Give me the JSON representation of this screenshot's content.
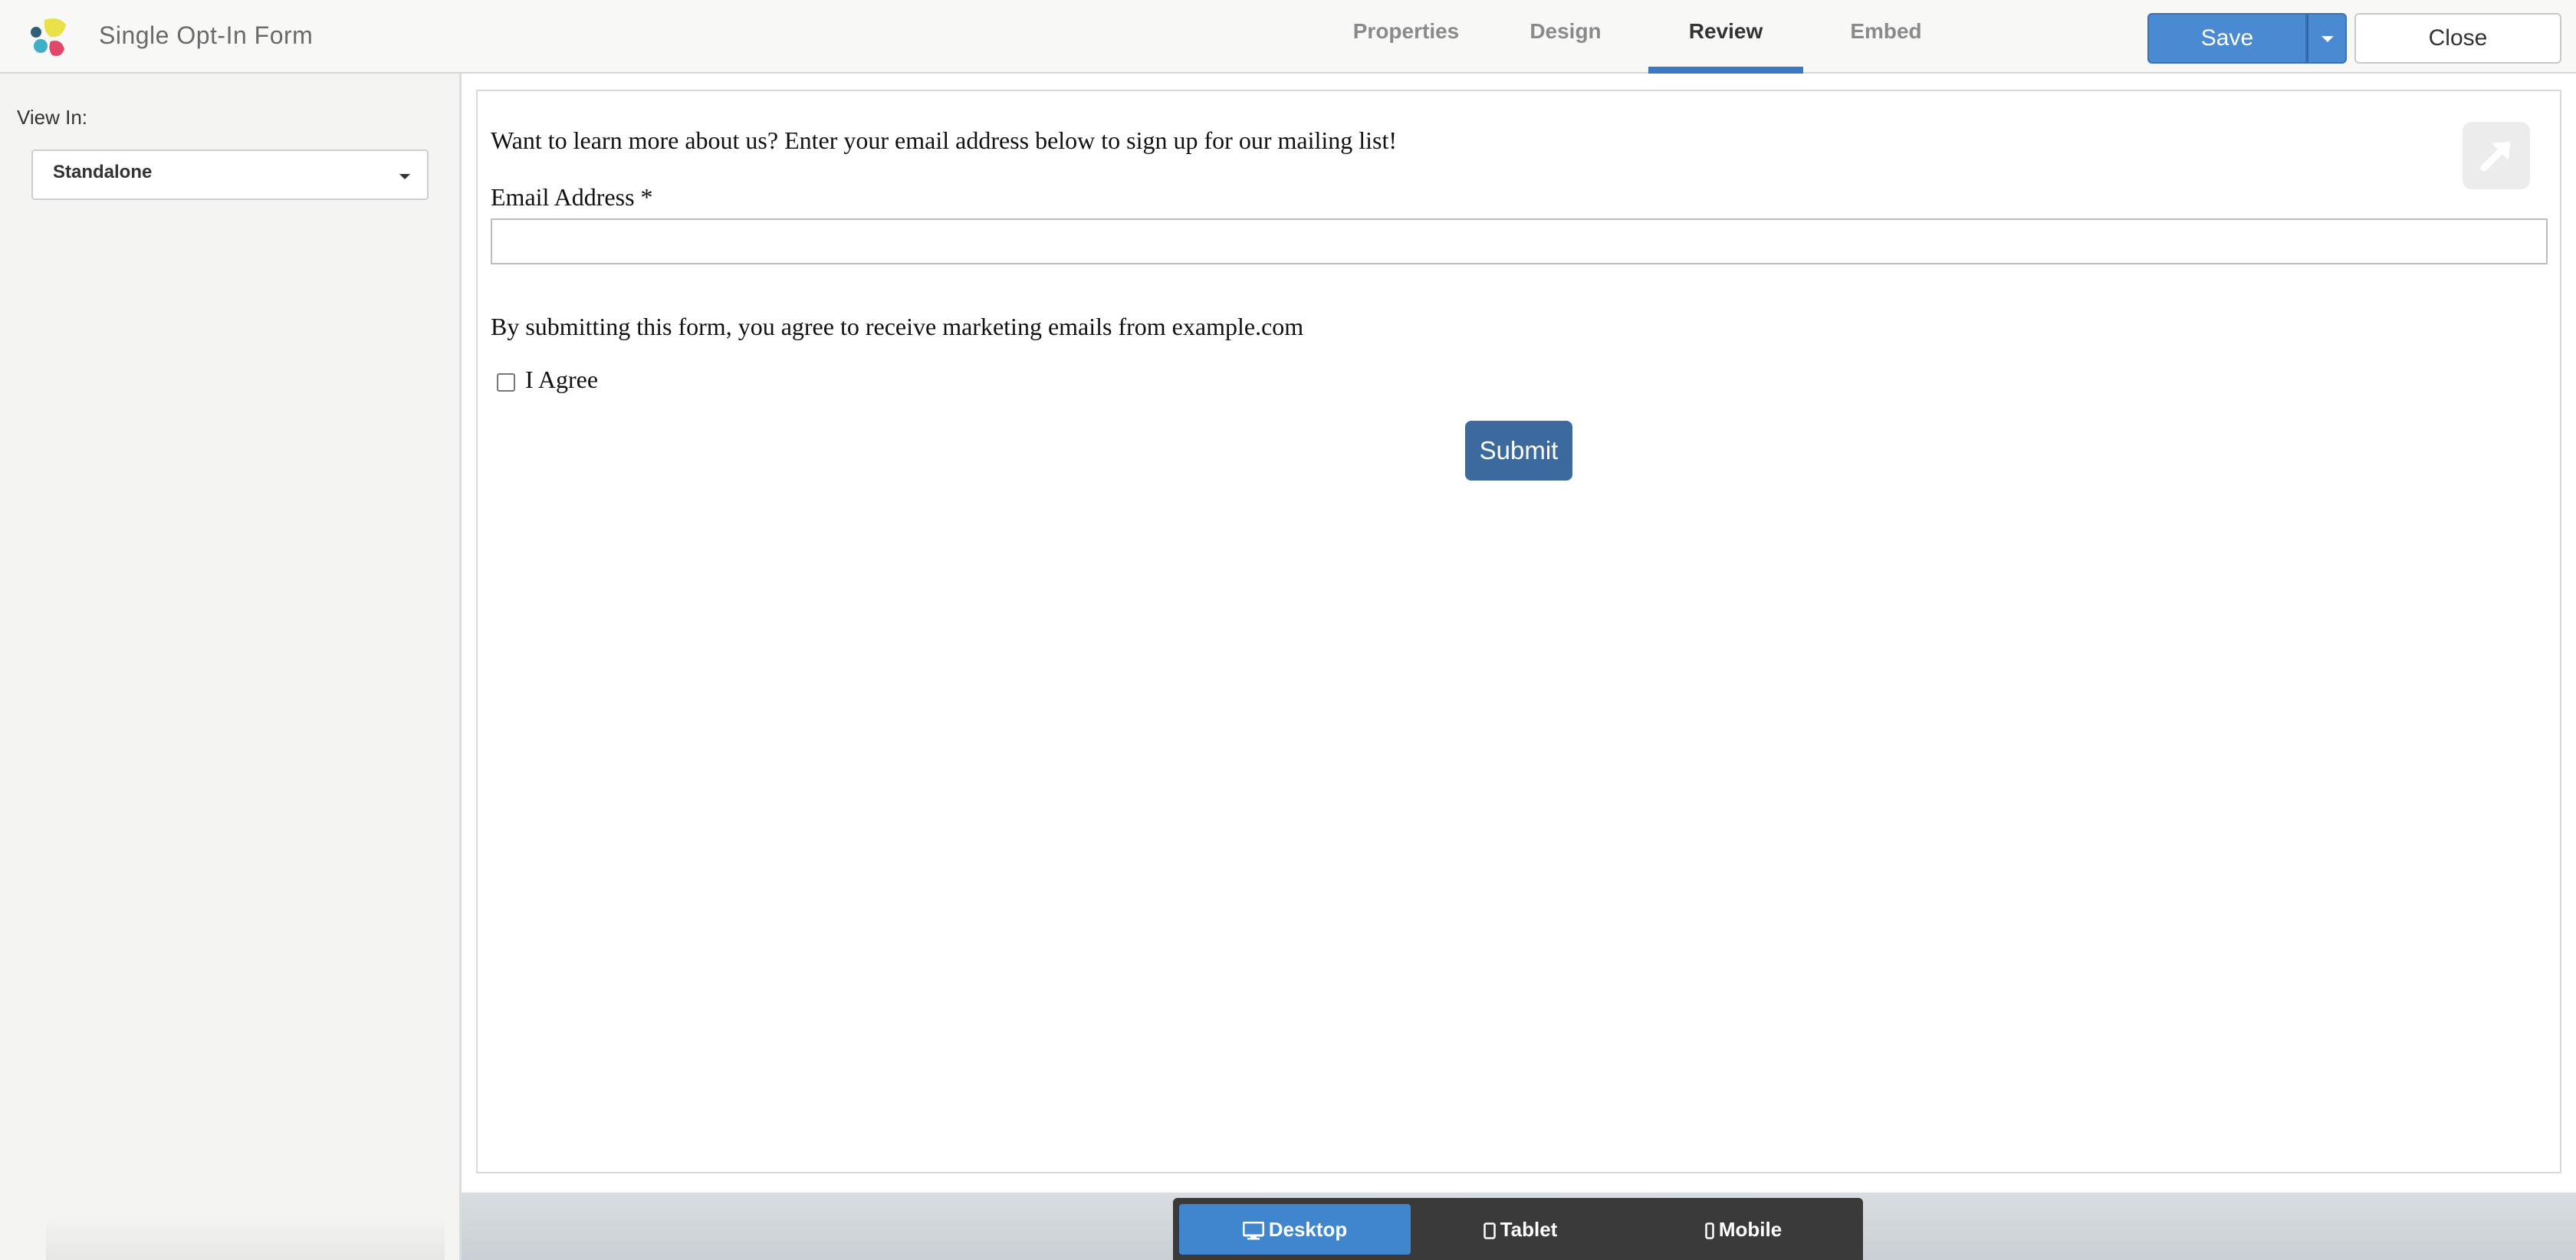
{
  "app": {
    "title": "Single Opt-In Form"
  },
  "tabs": [
    {
      "label": "Properties",
      "active": false
    },
    {
      "label": "Design",
      "active": false
    },
    {
      "label": "Review",
      "active": true
    },
    {
      "label": "Embed",
      "active": false
    }
  ],
  "actions": {
    "save_label": "Save",
    "close_label": "Close"
  },
  "sidebar": {
    "view_in_label": "View In:",
    "view_in_selected": "Standalone"
  },
  "form": {
    "intro": "Want to learn more about us? Enter your email address below to sign up for our mailing list!",
    "email_label": "Email Address *",
    "email_value": "",
    "consent_text": "By submitting this form, you agree to receive marketing emails from example.com",
    "agree_label": "I Agree",
    "agree_checked": false,
    "submit_label": "Submit"
  },
  "devices": [
    {
      "label": "Desktop",
      "icon": "desktop-icon",
      "active": true
    },
    {
      "label": "Tablet",
      "icon": "tablet-icon",
      "active": false
    },
    {
      "label": "Mobile",
      "icon": "mobile-icon",
      "active": false
    }
  ],
  "colors": {
    "accent": "#4a8ad3",
    "active_tab_underline": "#3b78c2",
    "submit": "#3d6a9e",
    "device_bar": "#3a3a3a"
  }
}
